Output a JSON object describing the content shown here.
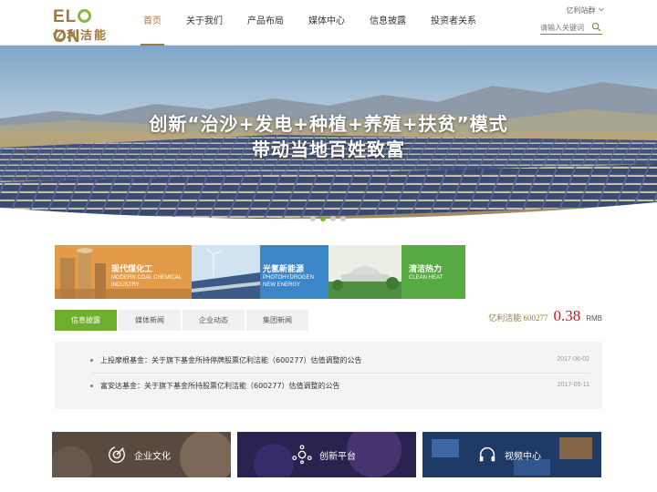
{
  "logo": {
    "en_prefix": "EL",
    "en_suffix": "ON",
    "cn": "亿利洁能"
  },
  "nav": {
    "items": [
      {
        "label": "首页",
        "active": true
      },
      {
        "label": "关于我们"
      },
      {
        "label": "产品布局"
      },
      {
        "label": "媒体中心"
      },
      {
        "label": "信息披露"
      },
      {
        "label": "投资者关系"
      }
    ]
  },
  "header": {
    "site_group": "亿利站群",
    "search_placeholder": "请输入关键词"
  },
  "banner": {
    "line1": "创新“治沙+发电+种植+养殖+扶贫”模式",
    "line2": "带动当地百姓致富",
    "slide_count": 4,
    "active_slide": 2
  },
  "categories": [
    {
      "title": "现代煤化工",
      "sub1": "MODERN COAL CHEMICAL",
      "sub2": "INDUSTRY"
    },
    {
      "title": "光氢新能源",
      "sub1": "PHOTOHYDROGEN",
      "sub2": "NEW ENERGY"
    },
    {
      "title": "清洁热力",
      "sub1": "CLEAN HEAT",
      "sub2": ""
    }
  ],
  "tabs": [
    {
      "label": "信息披露",
      "active": true
    },
    {
      "label": "媒体新闻"
    },
    {
      "label": "企业动态"
    },
    {
      "label": "集团新闻"
    }
  ],
  "stock": {
    "name": "亿利洁能 600277",
    "price": "0.38",
    "unit": "RMB"
  },
  "news": [
    {
      "title": "上投摩根基金：关于旗下基金所持停牌股票亿利洁能（600277）估值调整的公告",
      "date": "2017-06-02"
    },
    {
      "title": "富安达基金：关于旗下基金所持股票亿利洁能（600277）估值调整的公告",
      "date": "2017-05-11"
    }
  ],
  "tiles": [
    {
      "label": "企业文化",
      "icon": "culture-icon"
    },
    {
      "label": "创新平台",
      "icon": "network-icon"
    },
    {
      "label": "视频中心",
      "icon": "headset-icon"
    }
  ],
  "colors": {
    "brand_gold": "#a07a3c",
    "accent_green": "#6fae2f",
    "price_red": "#c8181f"
  }
}
